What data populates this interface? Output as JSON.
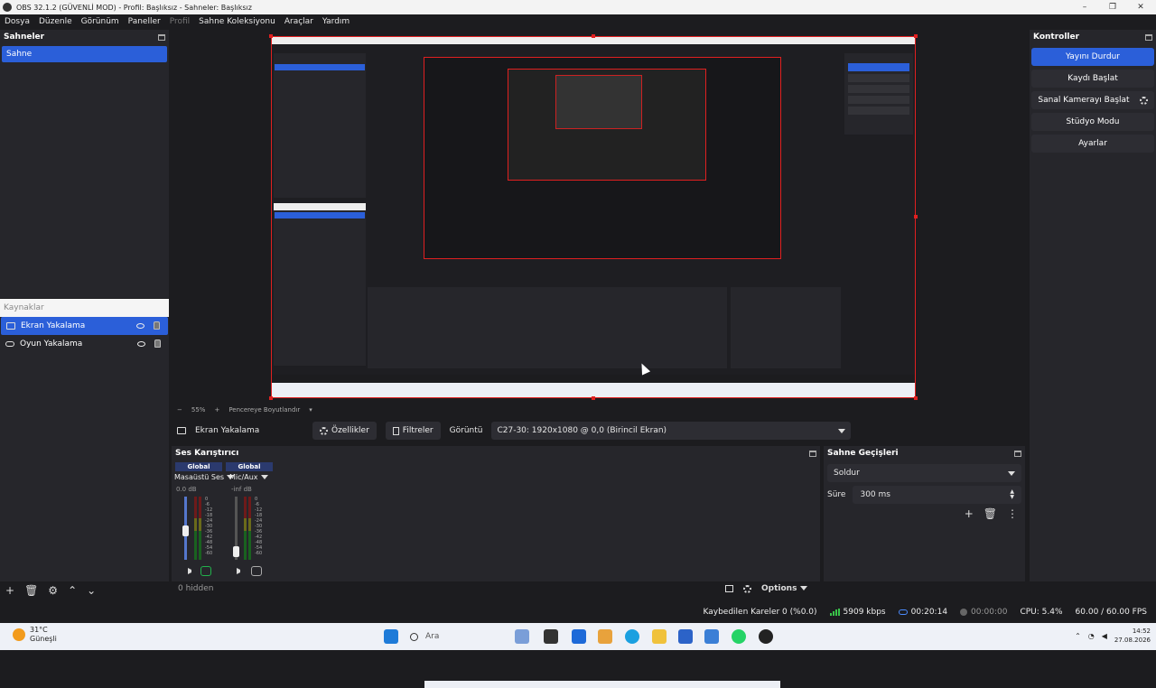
{
  "window": {
    "title": "OBS 32.1.2 (GÜVENLİ MOD) - Profil: Başlıksız - Sahneler: Başlıksız",
    "controls": [
      "–",
      "❐",
      "✕"
    ]
  },
  "menu": [
    "Dosya",
    "Düzenle",
    "Görünüm",
    "Paneller",
    "Profil",
    "Sahne Koleksiyonu",
    "Araçlar",
    "Yardım"
  ],
  "scenes": {
    "title": "Sahneler",
    "items": [
      "Sahne"
    ]
  },
  "sources": {
    "title": "Kaynaklar",
    "items": [
      {
        "label": "Ekran Yakalama",
        "icon": "monitor-icon",
        "selected": true
      },
      {
        "label": "Oyun Yakalama",
        "icon": "gamepad-icon",
        "selected": false
      }
    ]
  },
  "preview": {
    "zoom_minus": "−",
    "zoom": "55%",
    "zoom_plus": "+",
    "fit_label": "Pencereye Boyutlandır",
    "fit_caret": "▾"
  },
  "context": {
    "source_name": "Ekran Yakalama",
    "properties": "Özellikler",
    "filters": "Filtreler",
    "display_label": "Görüntü",
    "display_value": "C27-30: 1920x1080 @ 0,0 (Birincil Ekran)"
  },
  "mixer": {
    "title": "Ses Karıştırıcı",
    "channels": [
      {
        "header": "Global",
        "name": "Masaüstü Ses",
        "db": "0.0 dB",
        "level": 0.45,
        "monitor_on": true
      },
      {
        "header": "Global",
        "name": "Mic/Aux",
        "db": "-inf dB",
        "level": 0.05,
        "monitor_on": false
      }
    ],
    "scale": [
      "0",
      "-6",
      "-12",
      "-18",
      "-24",
      "-30",
      "-36",
      "-42",
      "-48",
      "-54",
      "-60"
    ]
  },
  "scene_toolbar": {
    "add": "+",
    "remove": "🗑",
    "settings": "⚙",
    "up": "⌃",
    "down": "⌄",
    "hidden": "0 hidden"
  },
  "mixer_toolbar": {
    "options": "Options"
  },
  "transitions": {
    "title": "Sahne Geçişleri",
    "selected": "Soldur",
    "duration_label": "Süre",
    "duration_value": "300 ms",
    "add": "+",
    "remove": "🗑",
    "more": "⋮"
  },
  "controls": {
    "title": "Kontroller",
    "buttons": [
      "Yayını Durdur",
      "Kaydı Başlat",
      "Sanal Kamerayı Başlat",
      "Stüdyo Modu",
      "Ayarlar"
    ]
  },
  "status": {
    "dropped_frames": "Kaybedilen Kareler 0 (%0.0)",
    "bitrate": "5909 kbps",
    "stream_time": "00:20:14",
    "record_time": "00:00:00",
    "cpu": "CPU: 5.4%",
    "fps": "60.00 / 60.00 FPS"
  },
  "taskbar": {
    "temp": "31°C",
    "weather": "Güneşli",
    "search": "Ara",
    "time": "14:52",
    "date": "27.08.2026"
  },
  "colors": {
    "accent": "#2b5fd9",
    "panel": "#26262b",
    "background": "#1c1c1f",
    "preview_border": "#e02020",
    "meter_green": "#22b24c"
  }
}
